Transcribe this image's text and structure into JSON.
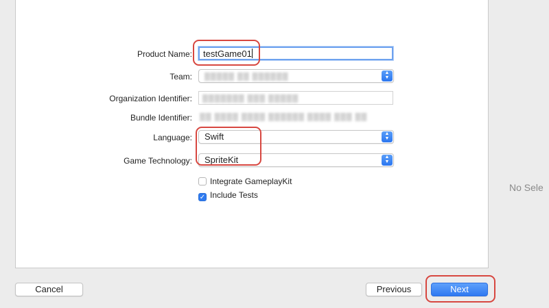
{
  "form": {
    "product_name": {
      "label": "Product Name:",
      "value": "testGame01"
    },
    "team": {
      "label": "Team:",
      "value": "▒▒▒▒▒ ▒▒ ▒▒▒▒▒▒"
    },
    "org_id": {
      "label": "Organization Identifier:",
      "value": "▒▒▒▒▒▒▒ ▒▒▒ ▒▒▒▒▒"
    },
    "bundle_id": {
      "label": "Bundle Identifier:",
      "value": "▒▒ ▒▒▒▒ ▒▒▒▒ ▒▒▒▒▒▒ ▒▒▒▒ ▒▒▒ ▒▒"
    },
    "language": {
      "label": "Language:",
      "value": "Swift"
    },
    "game_tech": {
      "label": "Game Technology:",
      "value": "SpriteKit"
    },
    "gameplaykit": {
      "label": "Integrate GameplayKit",
      "checked": false
    },
    "include_tests": {
      "label": "Include Tests",
      "checked": true
    }
  },
  "right_panel": {
    "text": "No Sele"
  },
  "footer": {
    "cancel": "Cancel",
    "previous": "Previous",
    "next": "Next"
  },
  "colors": {
    "accent": "#2f79f1",
    "highlight": "#d7463f"
  },
  "icons": {
    "checkmark": "checkmark-icon",
    "stepper": "up-down-chevron-icon"
  }
}
